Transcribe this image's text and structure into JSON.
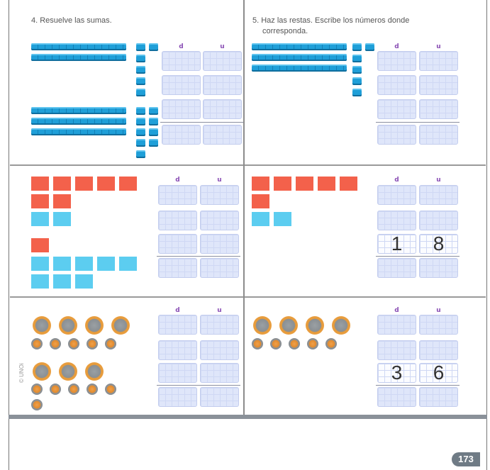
{
  "exercise4": {
    "title": "4. Resuelve las sumas."
  },
  "exercise5": {
    "title_line1": "5. Haz las restas. Escribe los números donde",
    "title_line2": "corresponda."
  },
  "table_headers": {
    "d": "d",
    "u": "u"
  },
  "answers": {
    "r2_right": {
      "d": "1",
      "u": "8"
    },
    "r3_right": {
      "d": "3",
      "u": "6"
    }
  },
  "copyright": "© UNOi",
  "page_number": "173",
  "colors": {
    "blue_rod": "#1f9fd8",
    "red_square": "#f3614b",
    "blue_square": "#5ccdf0",
    "coin": "#f1a64a",
    "header": "#8a4fb5"
  }
}
